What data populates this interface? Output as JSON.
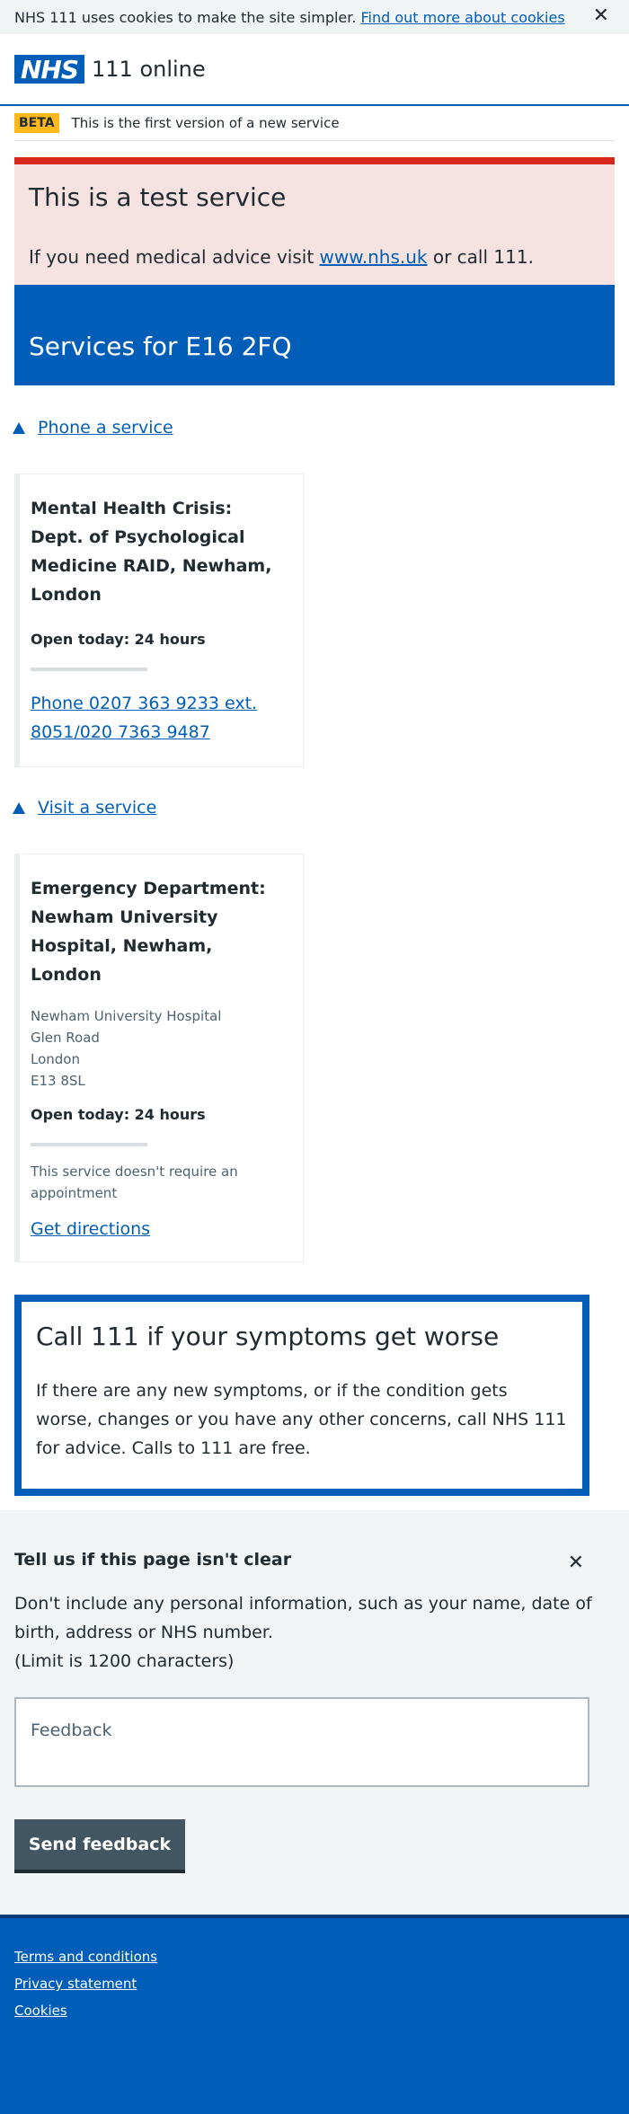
{
  "cookie_banner": {
    "message": "NHS 111 uses cookies to make the site simpler.",
    "link_label": "Find out more about cookies",
    "close_glyph": "✕"
  },
  "header": {
    "logo_text": "NHS",
    "service_name": "111 online"
  },
  "phase_banner": {
    "tag": "BETA",
    "text": "This is the first version of a new service"
  },
  "test_warning": {
    "title": "This is a test service",
    "text_before": "If you need medical advice visit ",
    "link": "www.nhs.uk",
    "text_after": " or call 111."
  },
  "services": {
    "title": "Services for E16 2FQ"
  },
  "phone_section": {
    "toggle_label": "Phone a service",
    "card": {
      "name": "Mental Health Crisis: Dept. of Psychological Medicine RAID, Newham, London",
      "opening": "Open today: 24 hours",
      "phone_link": "Phone 0207 363 9233 ext. 8051/020 7363 9487"
    }
  },
  "visit_section": {
    "toggle_label": "Visit a service",
    "card": {
      "name": "Emergency Department: Newham University Hospital, Newham, London",
      "address": [
        "Newham University Hospital",
        "Glen Road",
        "London",
        "E13 8SL"
      ],
      "opening": "Open today: 24 hours",
      "note": "This service doesn't require an appointment",
      "directions_link": "Get directions"
    }
  },
  "care_card": {
    "title": "Call 111 if your symptoms get worse",
    "text": "If there are any new symptoms, or if the condition gets worse, changes or you have any other concerns, call NHS 111 for advice. Calls to 111 are free."
  },
  "feedback": {
    "title": "Tell us if this page isn't clear",
    "close_glyph": "✕",
    "info": "Don't include any personal information, such as your name, date of birth, address or NHS number.",
    "limit": "(Limit is 1200 characters)",
    "placeholder": "Feedback",
    "button_label": "Send feedback"
  },
  "footer": {
    "links": [
      "Terms and conditions",
      "Privacy statement",
      "Cookies"
    ]
  },
  "colors": {
    "nhs_blue": "#005eb8",
    "warning_red": "#d5281b",
    "warning_bg": "#f6e2e1",
    "beta_yellow": "#ffb81c",
    "button_grey": "#425563"
  }
}
